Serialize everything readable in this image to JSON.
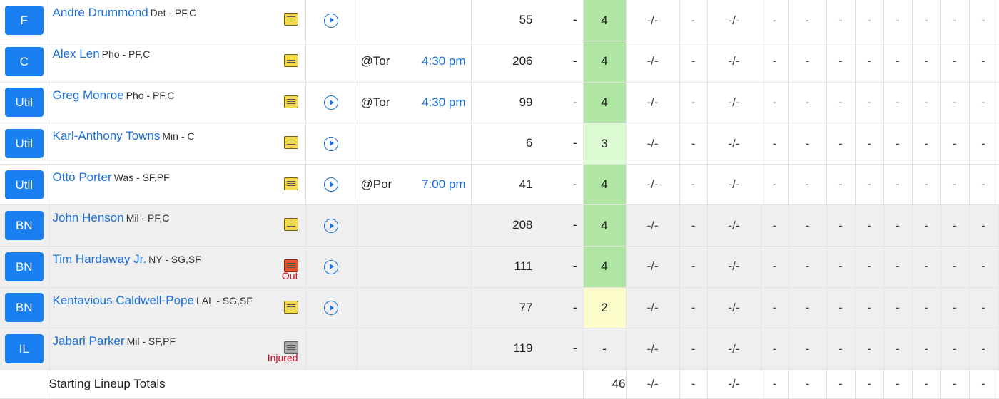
{
  "players": [
    {
      "pos": "F",
      "name": "Andre Drummond",
      "team": "Det - PF,C",
      "note": "normal",
      "status": "",
      "play": true,
      "opp": "",
      "time": "",
      "rank": "55",
      "dash": "-",
      "gp": "4",
      "gp_level": "high"
    },
    {
      "pos": "C",
      "name": "Alex Len",
      "team": "Pho - PF,C",
      "note": "normal",
      "status": "",
      "play": false,
      "opp": "@Tor",
      "time": "4:30 pm",
      "rank": "206",
      "dash": "-",
      "gp": "4",
      "gp_level": "high"
    },
    {
      "pos": "Util",
      "name": "Greg Monroe",
      "team": "Pho - PF,C",
      "note": "normal",
      "status": "",
      "play": true,
      "opp": "@Tor",
      "time": "4:30 pm",
      "rank": "99",
      "dash": "-",
      "gp": "4",
      "gp_level": "high"
    },
    {
      "pos": "Util",
      "name": "Karl-Anthony Towns",
      "team": "Min - C",
      "note": "normal",
      "status": "",
      "play": true,
      "opp": "",
      "time": "",
      "rank": "6",
      "dash": "-",
      "gp": "3",
      "gp_level": "mid"
    },
    {
      "pos": "Util",
      "name": "Otto Porter",
      "team": "Was - SF,PF",
      "note": "normal",
      "status": "",
      "play": true,
      "opp": "@Por",
      "time": "7:00 pm",
      "rank": "41",
      "dash": "-",
      "gp": "4",
      "gp_level": "high"
    },
    {
      "pos": "BN",
      "name": "John Henson",
      "team": "Mil - PF,C",
      "note": "normal",
      "status": "",
      "play": true,
      "opp": "",
      "time": "",
      "rank": "208",
      "dash": "-",
      "gp": "4",
      "gp_level": "high"
    },
    {
      "pos": "BN",
      "name": "Tim Hardaway Jr.",
      "team": "NY - SG,SF",
      "note": "out",
      "status": "Out",
      "play": true,
      "opp": "",
      "time": "",
      "rank": "111",
      "dash": "-",
      "gp": "4",
      "gp_level": "high"
    },
    {
      "pos": "BN",
      "name": "Kentavious Caldwell-Pope",
      "team": "LAL - SG,SF",
      "note": "normal",
      "status": "",
      "play": true,
      "opp": "",
      "time": "",
      "rank": "77",
      "dash": "-",
      "gp": "2",
      "gp_level": "low"
    },
    {
      "pos": "IL",
      "name": "Jabari Parker",
      "team": "Mil - SF,PF",
      "note": "injured",
      "status": "Injured",
      "play": false,
      "opp": "",
      "time": "",
      "rank": "119",
      "dash": "-",
      "gp": "-",
      "gp_level": "none"
    }
  ],
  "stat_columns": [
    "-/-",
    "-",
    "-/-",
    "-",
    "-",
    "-",
    "-",
    "-",
    "-",
    "-",
    "-",
    "-"
  ],
  "totals": {
    "label": "Starting Lineup Totals",
    "gp": "46",
    "stats": [
      "-/-",
      "-",
      "-/-",
      "-",
      "-",
      "-",
      "-",
      "-",
      "-",
      "-",
      "-",
      "-"
    ]
  },
  "colors": {
    "accent": "#1a7ff0",
    "link": "#1a6fd9",
    "gp_high": "#b0e6a4",
    "gp_mid": "#ddfbd2",
    "gp_low": "#fcfccb",
    "bench_bg": "#efefef",
    "status_red": "#d0021b"
  }
}
